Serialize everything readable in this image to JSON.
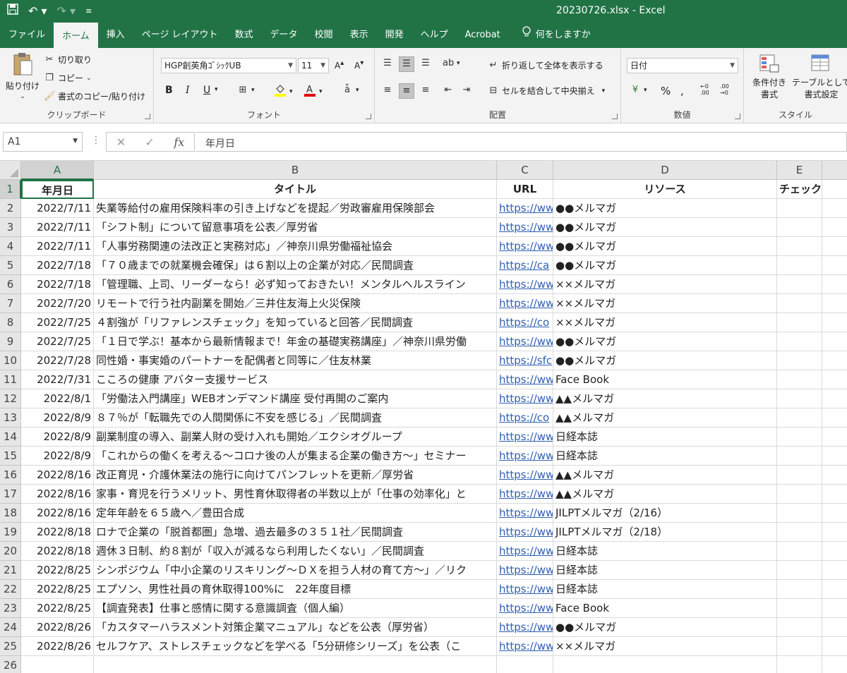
{
  "window": {
    "title": "20230726.xlsx  -  Excel"
  },
  "tabs": [
    "ファイル",
    "ホーム",
    "挿入",
    "ページ レイアウト",
    "数式",
    "データ",
    "校閲",
    "表示",
    "開発",
    "ヘルプ",
    "Acrobat"
  ],
  "active_tab": "ホーム",
  "tell_me": "何をしますか",
  "ribbon": {
    "clipboard": {
      "paste": "貼り付け",
      "cut": "切り取り",
      "copy": "コピー",
      "format_painter": "書式のコピー/貼り付け",
      "label": "クリップボード"
    },
    "font": {
      "name": "HGP創英角ｺﾞｼｯｸUB",
      "size": "11",
      "label": "フォント",
      "bold": "B",
      "italic": "I",
      "underline": "U"
    },
    "alignment": {
      "wrap": "折り返して全体を表示する",
      "merge": "セルを結合して中央揃え",
      "label": "配置"
    },
    "number": {
      "format": "日付",
      "label": "数値"
    },
    "styles": {
      "conditional": "条件付き",
      "conditional2": "書式",
      "table": "テーブルとして",
      "table2": "書式設定",
      "label": "スタイル"
    }
  },
  "formula_bar": {
    "name_box": "A1",
    "value": "年月日"
  },
  "columns": [
    "A",
    "B",
    "C",
    "D",
    "E"
  ],
  "headers": [
    "年月日",
    "タイトル",
    "URL",
    "リソース",
    "チェック"
  ],
  "rows": [
    {
      "date": "2022/7/11",
      "title": "失業等給付の雇用保険料率の引き上げなどを提起／労政審雇用保険部会",
      "url": "https://ww",
      "resource": "●●メルマガ"
    },
    {
      "date": "2022/7/11",
      "title": "「シフト制」について留意事項を公表／厚労省",
      "url": "https://ww",
      "resource": "●●メルマガ"
    },
    {
      "date": "2022/7/11",
      "title": "「人事労務関連の法改正と実務対応」／神奈川県労働福祉協会",
      "url": "https://ww",
      "resource": "●●メルマガ"
    },
    {
      "date": "2022/7/18",
      "title": "「７０歳までの就業機会確保」は６割以上の企業が対応／民間調査",
      "url": "https://ca",
      "resource": "●●メルマガ"
    },
    {
      "date": "2022/7/18",
      "title": "「管理職、上司、リーダーなら！必ず知っておきたい！メンタルヘルスライン",
      "url": "https://ww",
      "resource": "××メルマガ"
    },
    {
      "date": "2022/7/20",
      "title": "リモートで行う社内副業を開始／三井住友海上火災保険",
      "url": "https://ww",
      "resource": "××メルマガ"
    },
    {
      "date": "2022/7/25",
      "title": "４割強が「リファレンスチェック」を知っていると回答／民間調査",
      "url": "https://co",
      "resource": "××メルマガ"
    },
    {
      "date": "2022/7/25",
      "title": "「１日で学ぶ！基本から最新情報まで！年金の基礎実務講座」／神奈川県労働",
      "url": "https://ww",
      "resource": "●●メルマガ"
    },
    {
      "date": "2022/7/28",
      "title": "同性婚・事実婚のパートナーを配偶者と同等に／住友林業",
      "url": "https://sfc",
      "resource": "●●メルマガ"
    },
    {
      "date": "2022/7/31",
      "title": "こころの健康 アバター支援サービス",
      "url": "https://ww",
      "resource": "Face Book"
    },
    {
      "date": "2022/8/1",
      "title": "「労働法入門講座」WEBオンデマンド講座 受付再開のご案内",
      "url": "https://ww",
      "resource": "▲▲メルマガ"
    },
    {
      "date": "2022/8/9",
      "title": "８７％が「転職先での人間関係に不安を感じる」／民間調査",
      "url": "https://co",
      "resource": "▲▲メルマガ"
    },
    {
      "date": "2022/8/9",
      "title": "副業制度の導入、副業人財の受け入れも開始／エクシオグループ",
      "url": "https://ww",
      "resource": "日経本誌"
    },
    {
      "date": "2022/8/9",
      "title": "「これからの働くを考える～コロナ後の人が集まる企業の働き方～」セミナー",
      "url": "https://ww",
      "resource": "日経本誌"
    },
    {
      "date": "2022/8/16",
      "title": "改正育児・介護休業法の施行に向けてパンフレットを更新／厚労省",
      "url": "https://ww",
      "resource": "▲▲メルマガ"
    },
    {
      "date": "2022/8/16",
      "title": "家事・育児を行うメリット、男性育休取得者の半数以上が「仕事の効率化」と",
      "url": "https://ww",
      "resource": "▲▲メルマガ"
    },
    {
      "date": "2022/8/16",
      "title": "定年年齢を６５歳へ／豊田合成",
      "url": "https://ww",
      "resource": "JILPTメルマガ（2/16）"
    },
    {
      "date": "2022/8/18",
      "title": "ロナで企業の「脱首都圏」急増、過去最多の３５１社／民間調査",
      "url": "https://ww",
      "resource": "JILPTメルマガ（2/18）"
    },
    {
      "date": "2022/8/18",
      "title": "週休３日制、約８割が「収入が減るなら利用したくない」／民間調査",
      "url": "https://ww",
      "resource": "日経本誌"
    },
    {
      "date": "2022/8/25",
      "title": "シンポジウム「中小企業のリスキリング～ＤＸを担う人材の育て方～」／リク",
      "url": "https://ww",
      "resource": "日経本誌"
    },
    {
      "date": "2022/8/25",
      "title": "エプソン、男性社員の育休取得100%に　22年度目標",
      "url": "https://ww",
      "resource": "日経本誌"
    },
    {
      "date": "2022/8/25",
      "title": "【調査発表】仕事と感情に関する意識調査（個人編）",
      "url": "https://ww",
      "resource": "Face Book"
    },
    {
      "date": "2022/8/26",
      "title": "「カスタマーハラスメント対策企業マニュアル」などを公表（厚労省）",
      "url": "https://ww",
      "resource": "●●メルマガ"
    },
    {
      "date": "2022/8/26",
      "title": "セルフケア、ストレスチェックなどを学べる「5分研修シリーズ」を公表（こ",
      "url": "https://ww",
      "resource": "××メルマガ"
    }
  ],
  "row_numbers": [
    "1",
    "2",
    "3",
    "4",
    "5",
    "6",
    "7",
    "8",
    "9",
    "10",
    "11",
    "12",
    "13",
    "14",
    "15",
    "16",
    "17",
    "18",
    "19",
    "20",
    "21",
    "22",
    "23",
    "24",
    "25",
    "26"
  ],
  "colors": {
    "excel_green": "#217346",
    "link": "#2f5fb2"
  }
}
